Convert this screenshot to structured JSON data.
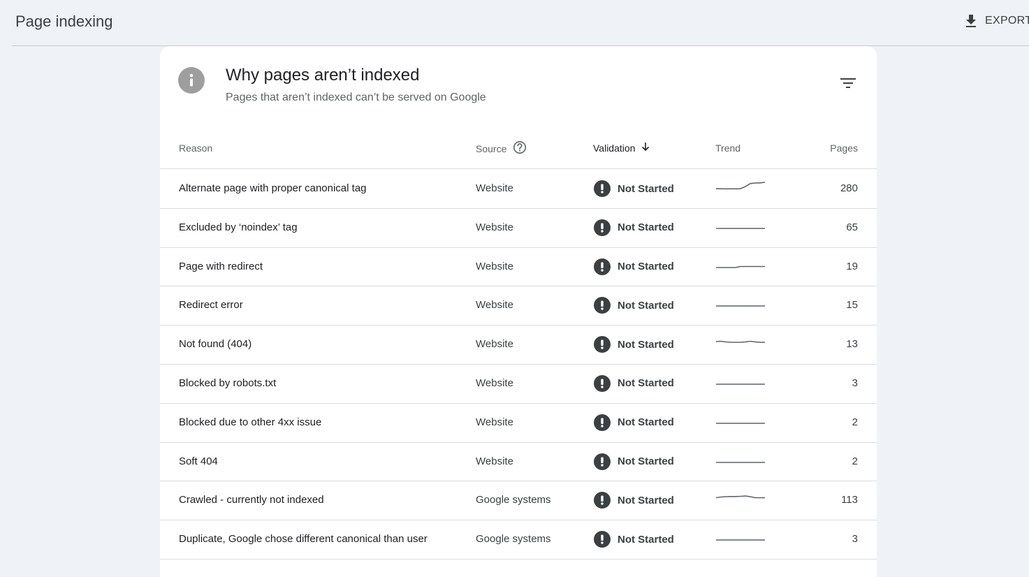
{
  "header": {
    "title": "Page indexing",
    "export_label": "EXPORT"
  },
  "card": {
    "title": "Why pages aren’t indexed",
    "subtitle": "Pages that aren’t indexed can’t be served on Google"
  },
  "table": {
    "columns": {
      "reason": "Reason",
      "source": "Source",
      "validation": "Validation",
      "trend": "Trend",
      "pages": "Pages"
    },
    "rows": [
      {
        "reason": "Alternate page with proper canonical tag",
        "source": "Website",
        "validation": "Not Started",
        "pages": "280",
        "trend": [
          0.08,
          0.08,
          0.07,
          0.07,
          0.07,
          0.08,
          0.4,
          0.82,
          0.9,
          0.92,
          1.0
        ]
      },
      {
        "reason": "Excluded by ‘noindex’ tag",
        "source": "Website",
        "validation": "Not Started",
        "pages": "65",
        "trend": [
          0.0,
          0.0,
          0.0,
          0.0,
          0.0,
          0.0,
          0.0,
          0.0,
          0.0,
          0.0,
          0.0
        ]
      },
      {
        "reason": "Page with redirect",
        "source": "Website",
        "validation": "Not Started",
        "pages": "19",
        "trend": [
          0.0,
          0.0,
          0.0,
          0.0,
          0.0,
          0.15,
          0.15,
          0.15,
          0.15,
          0.15,
          0.15
        ]
      },
      {
        "reason": "Redirect error",
        "source": "Website",
        "validation": "Not Started",
        "pages": "15",
        "trend": [
          0.0,
          0.0,
          0.0,
          0.0,
          0.0,
          0.0,
          0.0,
          0.0,
          0.0,
          0.0,
          0.0
        ]
      },
      {
        "reason": "Not found (404)",
        "source": "Website",
        "validation": "Not Started",
        "pages": "13",
        "trend": [
          0.5,
          0.55,
          0.45,
          0.4,
          0.4,
          0.4,
          0.45,
          0.55,
          0.45,
          0.4,
          0.4
        ]
      },
      {
        "reason": "Blocked by robots.txt",
        "source": "Website",
        "validation": "Not Started",
        "pages": "3",
        "trend": [
          0.0,
          0.0,
          0.0,
          0.0,
          0.0,
          0.0,
          0.0,
          0.0,
          0.0,
          0.0,
          0.0
        ]
      },
      {
        "reason": "Blocked due to other 4xx issue",
        "source": "Website",
        "validation": "Not Started",
        "pages": "2",
        "trend": [
          0.0,
          0.0,
          0.0,
          0.0,
          0.0,
          0.0,
          0.0,
          0.0,
          0.0,
          0.0,
          0.0
        ]
      },
      {
        "reason": "Soft 404",
        "source": "Website",
        "validation": "Not Started",
        "pages": "2",
        "trend": [
          0.0,
          0.0,
          0.0,
          0.0,
          0.0,
          0.0,
          0.0,
          0.0,
          0.0,
          0.0,
          0.0
        ]
      },
      {
        "reason": "Crawled - currently not indexed",
        "source": "Google systems",
        "validation": "Not Started",
        "pages": "113",
        "trend": [
          0.45,
          0.55,
          0.6,
          0.62,
          0.62,
          0.65,
          0.7,
          0.6,
          0.45,
          0.45,
          0.45
        ]
      },
      {
        "reason": "Duplicate, Google chose different canonical than user",
        "source": "Google systems",
        "validation": "Not Started",
        "pages": "3",
        "trend": [
          0.0,
          0.0,
          0.0,
          0.0,
          0.0,
          0.0,
          0.0,
          0.0,
          0.0,
          0.0,
          0.0
        ]
      }
    ]
  },
  "colors": {
    "background": "#eff2f6",
    "card": "#ffffff",
    "info_icon": "#9e9e9e",
    "warning_icon": "#3c4043",
    "sparkline": "#5f6368",
    "divider": "#dadce0"
  },
  "icons": {
    "export": "download-icon",
    "info": "info-icon",
    "filter": "filter-icon",
    "help": "help-circle-icon",
    "sort": "arrow-down-icon",
    "status": "exclamation-circle-icon"
  }
}
